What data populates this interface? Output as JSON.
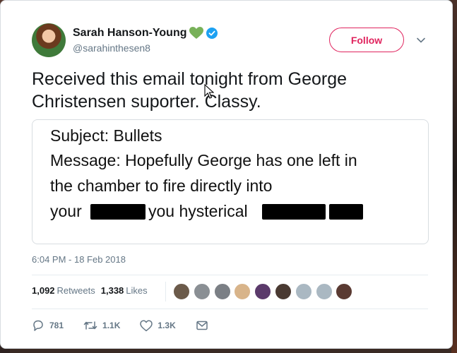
{
  "user": {
    "display_name": "Sarah Hanson-Young",
    "handle": "@sarahinthesen8",
    "emoji_icon": "green-heart",
    "verified": true
  },
  "follow_label": "Follow",
  "tweet_text_line1": "Received this email tonight from George",
  "tweet_text_line2": "Christensen suporter. Classy.",
  "media": {
    "line1": "Subject: Bullets",
    "line2": "Message: Hopefully George has one left in",
    "line3": "the chamber to fire directly into",
    "line4_start": "your",
    "line4_mid": "you hysterical"
  },
  "timestamp": "6:04 PM - 18 Feb 2018",
  "stats": {
    "retweets_count": "1,092",
    "retweets_label": "Retweets",
    "likes_count": "1,338",
    "likes_label": "Likes"
  },
  "likers": [
    {
      "color": "#6b5a4a"
    },
    {
      "color": "#8a8f94"
    },
    {
      "color": "#7b7f85"
    },
    {
      "color": "#d8b48a"
    },
    {
      "color": "#5b3a6b"
    },
    {
      "color": "#4a3a32"
    },
    {
      "color": "#aab8c2"
    },
    {
      "color": "#aab8c2"
    },
    {
      "color": "#5a3a32"
    }
  ],
  "actions": {
    "reply_count": "781",
    "retweet_count": "1.1K",
    "like_count": "1.3K"
  },
  "colors": {
    "accent": "#e0245e",
    "verified": "#1da1f2",
    "heart": "#78b159"
  }
}
